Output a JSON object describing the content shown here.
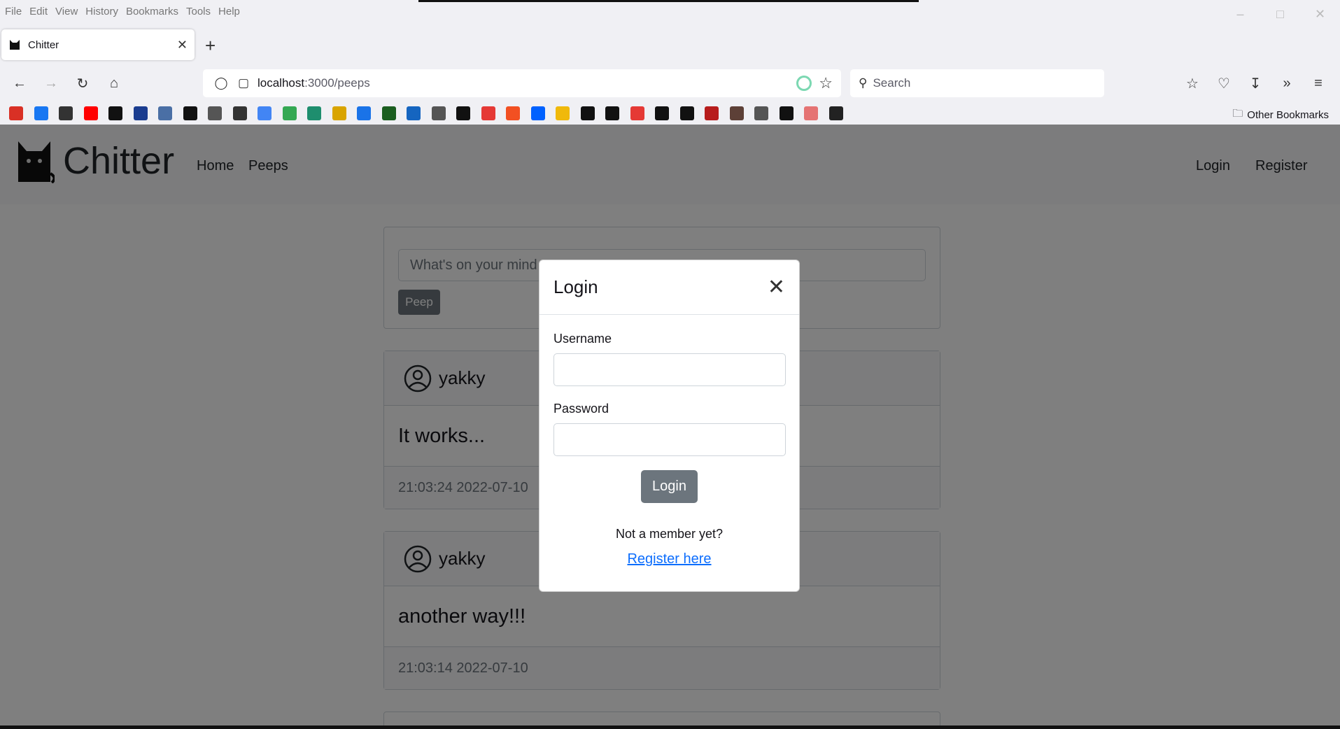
{
  "browser": {
    "menu": [
      "File",
      "Edit",
      "View",
      "History",
      "Bookmarks",
      "Tools",
      "Help"
    ],
    "tab_title": "Chitter",
    "url_host": "localhost",
    "url_path": ":3000/peeps",
    "search_placeholder": "Search",
    "other_bookmarks": "Other Bookmarks",
    "bookmark_icons": [
      "gmail-icon",
      "facebook-icon",
      "wikipedia-icon",
      "youtube-icon",
      "l-icon",
      "tfl-icon",
      "bag-icon",
      "amazon-icon",
      "globe-icon",
      "wordpress-icon",
      "google-icon",
      "google-icon",
      "green-icon",
      "rockpaper-icon",
      "blue-icon",
      "green-box-icon",
      "blue-box-icon",
      "globe-icon",
      "dots-icon",
      "k-icon",
      "microsoft-icon",
      "dropbox-icon",
      "binance-icon",
      "hl-icon",
      "red-icon",
      "ig-icon",
      "d-icon",
      "tv-icon",
      "flag-icon",
      "lion-icon",
      "doc-icon",
      "github-icon",
      "red-box-icon",
      "dark-box-icon"
    ]
  },
  "site": {
    "brand": "Chitter",
    "nav": {
      "home": "Home",
      "peeps": "Peeps",
      "login": "Login",
      "register": "Register"
    },
    "composer": {
      "placeholder": "What's on your mind",
      "button": "Peep"
    },
    "peeps": [
      {
        "user": "yakky",
        "text": "It works...",
        "time": "21:03:24 2022-07-10"
      },
      {
        "user": "yakky",
        "text": "another way!!!",
        "time": "21:03:14 2022-07-10"
      }
    ]
  },
  "modal": {
    "title": "Login",
    "username_label": "Username",
    "password_label": "Password",
    "submit": "Login",
    "not_member": "Not a member yet?",
    "register_link": "Register here"
  }
}
